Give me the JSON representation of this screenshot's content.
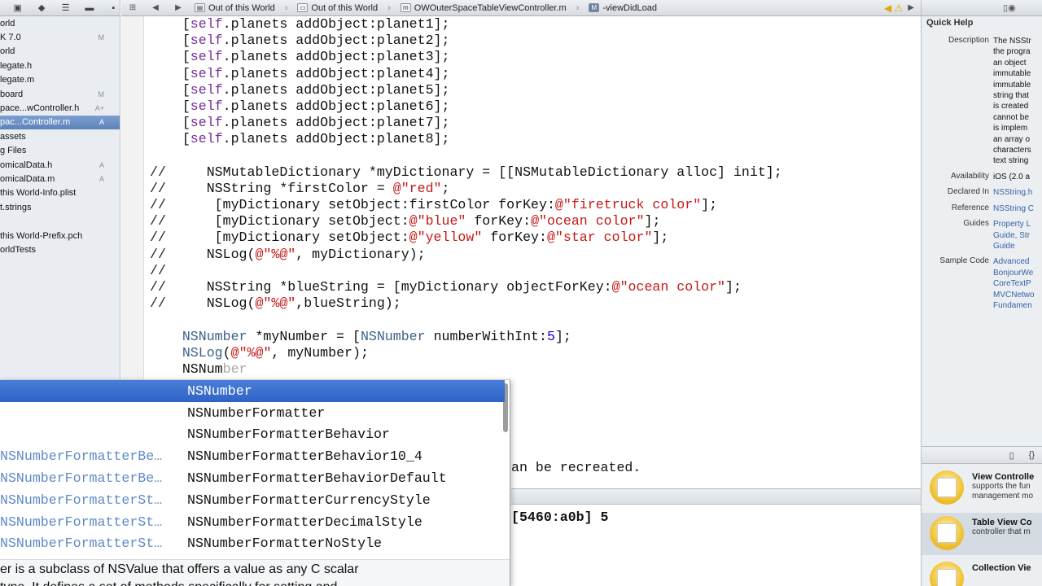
{
  "navigator": {
    "toolbar_icons": [
      "folder-icon",
      "diamond-icon",
      "list-icon",
      "toggle-icon",
      "comment-icon"
    ],
    "items": [
      {
        "label": "orld",
        "badge": ""
      },
      {
        "label": "K 7.0",
        "badge": "M"
      },
      {
        "label": "orld",
        "badge": ""
      },
      {
        "label": "legate.h",
        "badge": ""
      },
      {
        "label": "legate.m",
        "badge": ""
      },
      {
        "label": "board",
        "badge": "M"
      },
      {
        "label": "pace...wController.h",
        "badge": "A+"
      },
      {
        "label": "pac...Controller.m",
        "badge": "A",
        "selected": true
      },
      {
        "label": "assets",
        "badge": ""
      },
      {
        "label": "g Files",
        "badge": ""
      },
      {
        "label": "omicalData.h",
        "badge": "A"
      },
      {
        "label": "omicalData.m",
        "badge": "A"
      },
      {
        "label": "this World-Info.plist",
        "badge": ""
      },
      {
        "label": "t.strings",
        "badge": ""
      },
      {
        "label": "",
        "badge": ""
      },
      {
        "label": "this World-Prefix.pch",
        "badge": ""
      },
      {
        "label": "orldTests",
        "badge": ""
      }
    ]
  },
  "jumpbar": {
    "crumbs": [
      "Out of this World",
      "Out of this World",
      "OWOuterSpaceTableViewController.m",
      "-viewDidLoad"
    ],
    "file_icon_text": "m",
    "method_icon_text": "M"
  },
  "code_lines": [
    "    [self.planets addObject:planet1];",
    "    [self.planets addObject:planet2];",
    "    [self.planets addObject:planet3];",
    "    [self.planets addObject:planet4];",
    "    [self.planets addObject:planet5];",
    "    [self.planets addObject:planet6];",
    "    [self.planets addObject:planet7];",
    "    [self.planets addObject:planet8];",
    "",
    "//     NSMutableDictionary *myDictionary = [[NSMutableDictionary alloc] init];",
    "//     NSString *firstColor = @\"red\";",
    "//      [myDictionary setObject:firstColor forKey:@\"firetruck color\"];",
    "//      [myDictionary setObject:@\"blue\" forKey:@\"ocean color\"];",
    "//      [myDictionary setObject:@\"yellow\" forKey:@\"star color\"];",
    "//     NSLog(@\"%@\", myDictionary);",
    "//",
    "//     NSString *blueString = [myDictionary objectForKey:@\"ocean color\"];",
    "//     NSLog(@\"%@\",blueString);",
    "",
    "    NSNumber *myNumber = [NSNumber numberWithInt:5];",
    "    NSLog(@\"%@\", myNumber);"
  ],
  "typing_line": {
    "typed": "    NSNum",
    "ghost": "ber"
  },
  "autocomplete": {
    "items": [
      {
        "type": "",
        "name": "NSNumber",
        "selected": true
      },
      {
        "type": "",
        "name": "NSNumberFormatter"
      },
      {
        "type": "",
        "name": "NSNumberFormatterBehavior"
      },
      {
        "type": "NSNumberFormatterBe…",
        "name": "NSNumberFormatterBehavior10_4"
      },
      {
        "type": "NSNumberFormatterBe…",
        "name": "NSNumberFormatterBehaviorDefault"
      },
      {
        "type": "NSNumberFormatterSt…",
        "name": "NSNumberFormatterCurrencyStyle"
      },
      {
        "type": "NSNumberFormatterSt…",
        "name": "NSNumberFormatterDecimalStyle"
      },
      {
        "type": "NSNumberFormatterSt…",
        "name": "NSNumberFormatterNoStyle"
      }
    ],
    "doc_text": "er is a subclass of NSValue that offers a value as any C scalar",
    "doc_text_2": "  type. It defines a set of methods specifically for setting and"
  },
  "editor_tail": "an be recreated.",
  "console_output": "[5460:a0b] 5",
  "quick_help": {
    "title": "Quick Help",
    "rows": [
      {
        "label": "Description",
        "values": [
          "The NSStr",
          "the progra",
          "an object",
          "immutable",
          "immutable",
          "string that",
          "is created",
          "cannot be",
          "is implem",
          "an array o",
          "characters",
          "text string"
        ],
        "link": false
      },
      {
        "label": "Availability",
        "values": [
          "iOS (2.0 a"
        ],
        "link": false
      },
      {
        "label": "Declared In",
        "values": [
          "NSString.h"
        ],
        "link": true
      },
      {
        "label": "Reference",
        "values": [
          "NSString C"
        ],
        "link": true
      },
      {
        "label": "Guides",
        "values": [
          "Property L",
          "Guide, Str",
          "Guide"
        ],
        "link": true
      },
      {
        "label": "Sample Code",
        "values": [
          "Advanced",
          "BonjourWe",
          "CoreTextP",
          "MVCNetwo",
          "Fundamen"
        ],
        "link": true
      }
    ]
  },
  "library": {
    "toolbar_icons": [
      "file-icon",
      "braces-icon"
    ],
    "items": [
      {
        "title": "View Controlle",
        "desc1": "supports the fun",
        "desc2": "management mo"
      },
      {
        "title": "Table View Co",
        "desc1": "controller that m",
        "desc2": ""
      },
      {
        "title": "Collection Vie",
        "desc1": "",
        "desc2": ""
      }
    ]
  }
}
